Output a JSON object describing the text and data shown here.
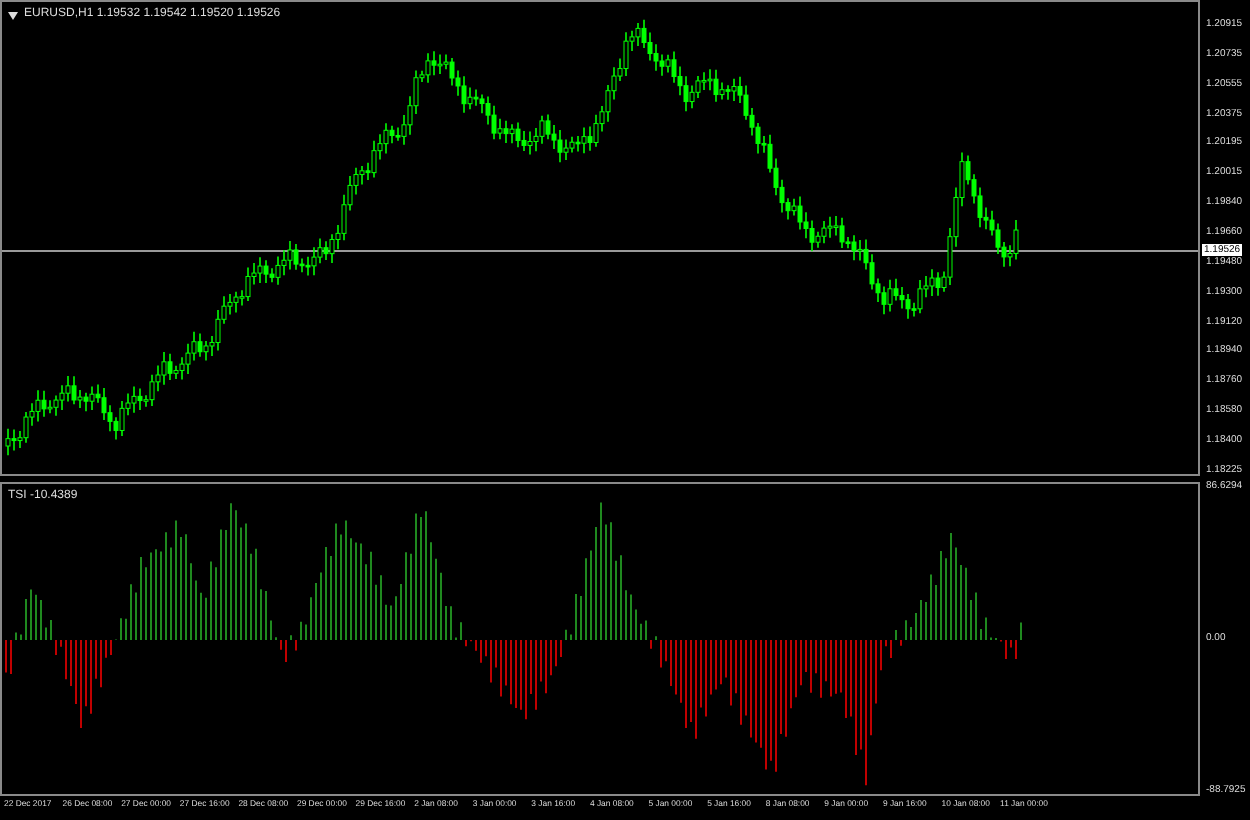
{
  "chart": {
    "title": "EURUSD,H1  1.19532 1.19542 1.19520 1.19526",
    "price_axis": [
      "1.20915",
      "1.20735",
      "1.20555",
      "1.20375",
      "1.20195",
      "1.20015",
      "1.19840",
      "1.19660",
      "1.19480",
      "1.19300",
      "1.19120",
      "1.18940",
      "1.18760",
      "1.18580",
      "1.18400",
      "1.18225"
    ],
    "current_price": "1.19526"
  },
  "indicator": {
    "title": "TSI -10.4389",
    "axis": [
      "86.6294",
      "0.00",
      "-88.7925"
    ]
  },
  "time_axis": [
    "22 Dec 2017",
    "26 Dec 08:00",
    "27 Dec 00:00",
    "27 Dec 16:00",
    "28 Dec 08:00",
    "29 Dec 00:00",
    "29 Dec 16:00",
    "2 Jan 08:00",
    "3 Jan 00:00",
    "3 Jan 16:00",
    "4 Jan 08:00",
    "5 Jan 00:00",
    "5 Jan 16:00",
    "8 Jan 08:00",
    "9 Jan 00:00",
    "9 Jan 16:00",
    "10 Jan 08:00",
    "11 Jan 00:00"
  ]
}
